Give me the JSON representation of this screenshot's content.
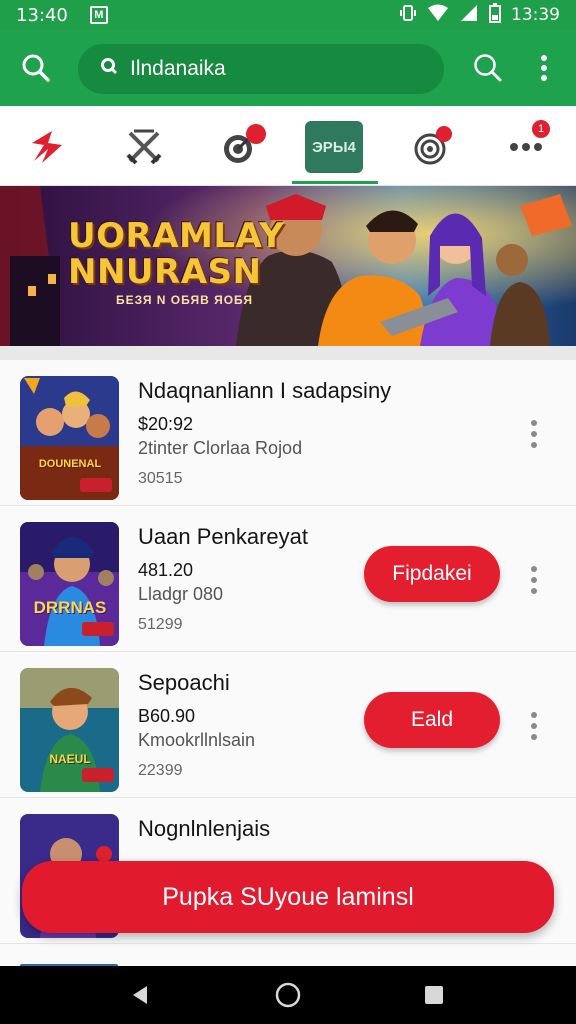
{
  "status_bar": {
    "time_left": "13:40",
    "time_right": "13:39"
  },
  "app_bar": {
    "search_value": "Ilndanaika"
  },
  "tabs": {
    "active_label": "ЭРЫ4",
    "badge_count": "1"
  },
  "banner": {
    "title_line1": "UORAMLAY",
    "title_line2": "NNURASN",
    "subtitle": "БЕЗЯ N ОБЯВ ЯОБЯ"
  },
  "items": [
    {
      "title": "Ndaqnanliann I sadapsiny",
      "price": "$20:92",
      "meta": "2tinter Clorlaa Rojod",
      "count": "30515",
      "action_label": "",
      "thumb_caption": "DOUNENAL",
      "accent": "#f0a81c"
    },
    {
      "title": "Uaan Penkareyat",
      "price": "481.20",
      "meta": "Lladgr 080",
      "count": "51299",
      "action_label": "Fipdakei",
      "thumb_caption": "DRRNAS",
      "accent": "#b63bd6"
    },
    {
      "title": "Sepoachi",
      "price": "B60.90",
      "meta": "Kmookrllnlsain",
      "count": "22399",
      "action_label": "Eald",
      "thumb_caption": "NAEUL",
      "accent": "#2aa8c9"
    },
    {
      "title": "Nognlnlenjais",
      "price": "",
      "meta": "",
      "count": "",
      "action_label": "",
      "thumb_caption": "",
      "accent": "#7a44c8"
    }
  ],
  "primary_button": {
    "label": "Pupka SUyoue laminsl"
  },
  "colors": {
    "brand_green": "#1ea24d",
    "accent_red": "#e21e2f"
  }
}
